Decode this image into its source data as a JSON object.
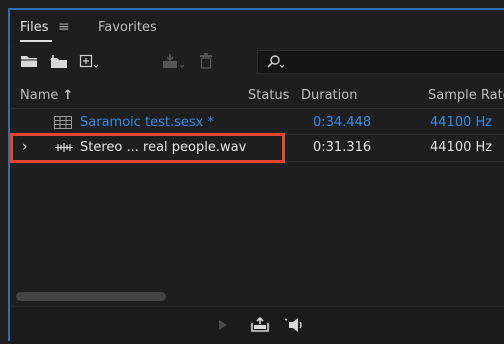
{
  "tabs": {
    "files_label": "Files",
    "menu_glyph": "≡",
    "favorites_label": "Favorites"
  },
  "toolbar": {
    "icons": [
      "open-folder-icon",
      "import-icon",
      "new-file-icon",
      "insert-into-multitrack-icon",
      "trash-icon"
    ],
    "search_placeholder": ""
  },
  "table": {
    "columns": {
      "name": "Name",
      "name_sort_glyph": "↑",
      "status": "Status",
      "duration": "Duration",
      "sample_rate": "Sample Rate"
    },
    "rows": [
      {
        "name": "Saramoic test.sesx *",
        "status": "",
        "duration": "0:34.448",
        "sample_rate": "44100 Hz",
        "type": "multitrack-session"
      },
      {
        "expand_glyph": "›",
        "name": "Stereo ... real people.wav",
        "status": "",
        "duration": "0:31.316",
        "sample_rate": "44100 Hz",
        "type": "audio-file"
      }
    ]
  },
  "bottom_bar": {
    "icons": [
      "play-icon",
      "export-icon",
      "auto-play-speaker-icon"
    ]
  },
  "colors": {
    "accent_blue": "#2d8ceb",
    "highlight_red": "#e5472d",
    "background": "#1e1e1e"
  }
}
